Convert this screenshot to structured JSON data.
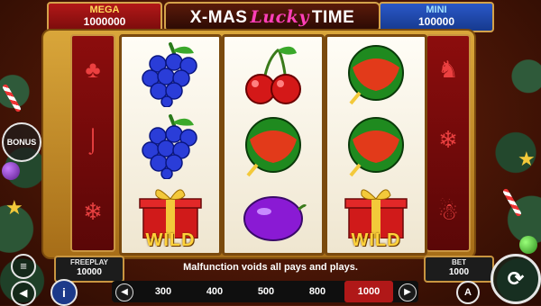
{
  "jackpots": {
    "mega": {
      "label": "MEGA",
      "value": "1000000"
    },
    "mini": {
      "label": "MINI",
      "value": "100000"
    }
  },
  "title": {
    "part1": "X-MAS",
    "lucky": "Lucky",
    "part2": "TIME"
  },
  "reels": [
    {
      "symbols": [
        "grapes",
        "grapes",
        "wild-gift"
      ]
    },
    {
      "symbols": [
        "cherries",
        "watermelon",
        "plum"
      ]
    },
    {
      "symbols": [
        "watermelon",
        "watermelon",
        "wild-gift"
      ]
    }
  ],
  "wild_label": "WILD",
  "side_reel_left_icons": [
    "tree-glyph",
    "candy-cane-glyph",
    "snowflake-glyph"
  ],
  "side_reel_right_icons": [
    "reindeer-glyph",
    "snowflake-glyph",
    "gingerbread-glyph"
  ],
  "bonus_button": {
    "label": "BONUS"
  },
  "freeplay": {
    "label": "FREEPLAY",
    "value": "10000"
  },
  "bet": {
    "label": "BET",
    "value": "1000"
  },
  "notice": "Malfunction voids all pays and plays.",
  "bet_options": {
    "options": [
      "300",
      "400",
      "500",
      "800",
      "1000"
    ],
    "selected": "1000"
  },
  "buttons": {
    "menu_icon": "menu-icon",
    "sound_icon": "speaker-icon",
    "info_icon": "info-icon",
    "auto_label": "A",
    "spin_icon": "spin-icon"
  },
  "colors": {
    "accent_gold": "#d4a24a",
    "mega_red": "#b21818",
    "mini_blue": "#2a58c8",
    "selected_bet": "#b01818"
  }
}
